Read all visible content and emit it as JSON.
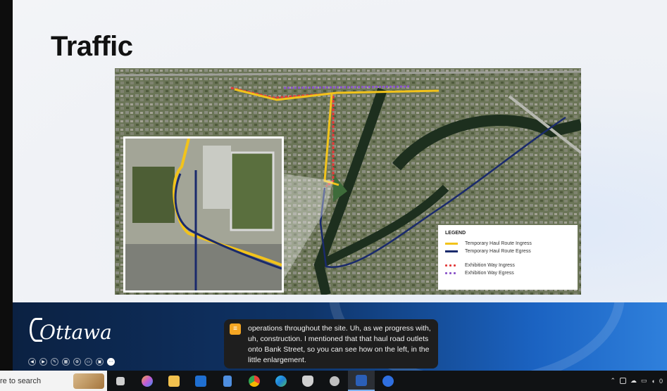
{
  "slide": {
    "title": "Traffic"
  },
  "legend": {
    "title": "LEGEND",
    "items": [
      {
        "label": "Temporary Haul Route Ingress",
        "color": "#f2c31b",
        "style": "solid"
      },
      {
        "label": "Temporary Haul Route Egress",
        "color": "#1a2a6c",
        "style": "solid"
      },
      {
        "label": "Exhibition Way Ingress",
        "color": "#e23a3a",
        "style": "dotted"
      },
      {
        "label": "Exhibition Way Egress",
        "color": "#8b55c9",
        "style": "dotted"
      }
    ]
  },
  "footer": {
    "logo_text": "Ottawa"
  },
  "caption": {
    "text": "operations throughout the site. Uh, as we progress with, uh, construction. I mentioned that that haul road outlets onto Bank Street, so you can see how on the left, in the little enlargement."
  },
  "taskbar": {
    "search_placeholder": "re to search",
    "apps": [
      {
        "name": "task-view-icon",
        "color": "#cfcfcf"
      },
      {
        "name": "copilot-icon",
        "color": "#c45bd6"
      },
      {
        "name": "file-explorer-icon",
        "color": "#f2c14e"
      },
      {
        "name": "outlook-icon",
        "color": "#1f6fd1"
      },
      {
        "name": "tablet-app-icon",
        "color": "#4f8fe0"
      },
      {
        "name": "chrome-icon",
        "color": "#e94235"
      },
      {
        "name": "edge-icon",
        "color": "#2ba6d8"
      },
      {
        "name": "shield-app-icon",
        "color": "#d0d0d0"
      },
      {
        "name": "settings-icon",
        "color": "#bfbfbf"
      },
      {
        "name": "word-icon",
        "color": "#2b5fb8"
      },
      {
        "name": "chat-app-icon",
        "color": "#2f6fe0"
      }
    ]
  }
}
